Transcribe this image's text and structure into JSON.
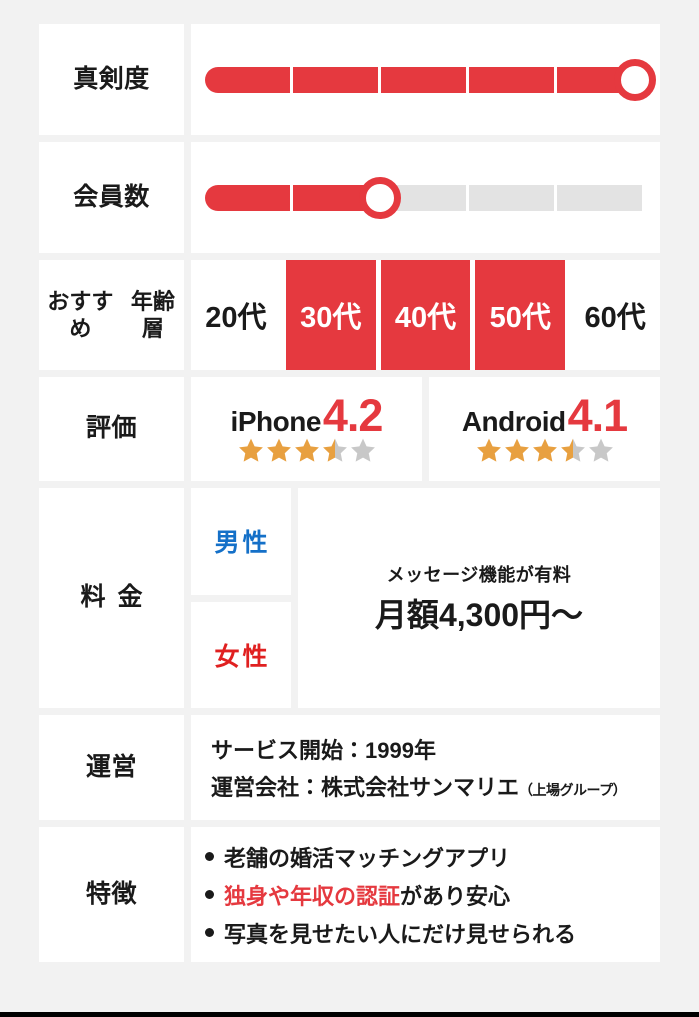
{
  "theme": {
    "accent_red": "#e5393f",
    "star_gold": "#e8a040",
    "star_gray": "#c8c8c8",
    "male_blue": "#1470c8",
    "female_red": "#e02020",
    "page_bg": "#f2f2f2",
    "cell_bg": "#ffffff"
  },
  "rows": {
    "seriousness": {
      "label": "真剣度",
      "filled": 5,
      "total": 5
    },
    "members": {
      "label": "会員数",
      "filled": 2,
      "total": 5
    },
    "age": {
      "label_line1": "おすすめ",
      "label_line2": "年齢層",
      "cells": [
        {
          "text": "20代",
          "active": false
        },
        {
          "text": "30代",
          "active": true
        },
        {
          "text": "40代",
          "active": true
        },
        {
          "text": "50代",
          "active": true
        },
        {
          "text": "60代",
          "active": false
        }
      ]
    },
    "rating": {
      "label": "評価",
      "groups": [
        {
          "os": "iPhone",
          "score": "4.2",
          "stars_full": 3,
          "stars_half": 1,
          "stars_empty": 1
        },
        {
          "os": "Android",
          "score": "4.1",
          "stars_full": 3,
          "stars_half": 1,
          "stars_empty": 1
        }
      ]
    },
    "price": {
      "label": "料金",
      "male_label": "男性",
      "female_label": "女性",
      "note": "メッセージ機能が有料",
      "amount": "月額4,300円〜"
    },
    "operator": {
      "label": "運営",
      "service_start": "サービス開始：1999年",
      "company": "運営会社：株式会社サンマリエ",
      "company_note": "（上場グループ）"
    },
    "features": {
      "label": "特徴",
      "items": [
        {
          "text": "老舗の婚活マッチングアプリ",
          "highlight": "",
          "tail": ""
        },
        {
          "text": "",
          "highlight": "独身や年収の認証",
          "tail": "があり安心"
        },
        {
          "text": "写真を見せたい人にだけ見せられる",
          "highlight": "",
          "tail": ""
        }
      ]
    }
  }
}
